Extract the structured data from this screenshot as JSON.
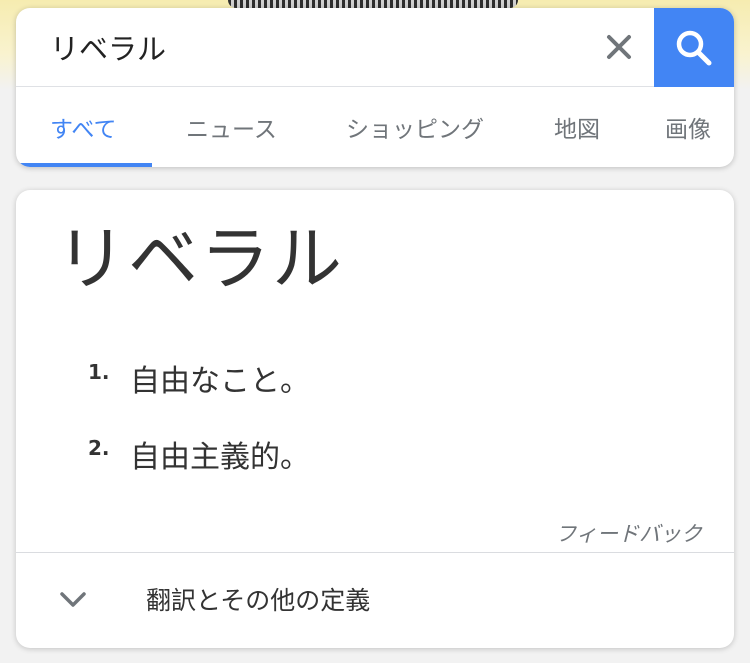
{
  "search": {
    "query": "リベラル"
  },
  "tabs": [
    {
      "label": "すべて"
    },
    {
      "label": "ニュース"
    },
    {
      "label": "ショッピング"
    },
    {
      "label": "地図"
    },
    {
      "label": "画像"
    }
  ],
  "definition": {
    "word": "リベラル",
    "items": [
      {
        "num": "1.",
        "text": "自由なこと。"
      },
      {
        "num": "2.",
        "text": "自由主義的。"
      }
    ],
    "feedback": "フィードバック",
    "more_label": "翻訳とその他の定義"
  },
  "colors": {
    "accent": "#4285f4",
    "text": "#333333",
    "muted": "#70757a"
  },
  "icons": {
    "clear": "close-icon",
    "search": "search-icon",
    "expand": "chevron-down-icon"
  }
}
